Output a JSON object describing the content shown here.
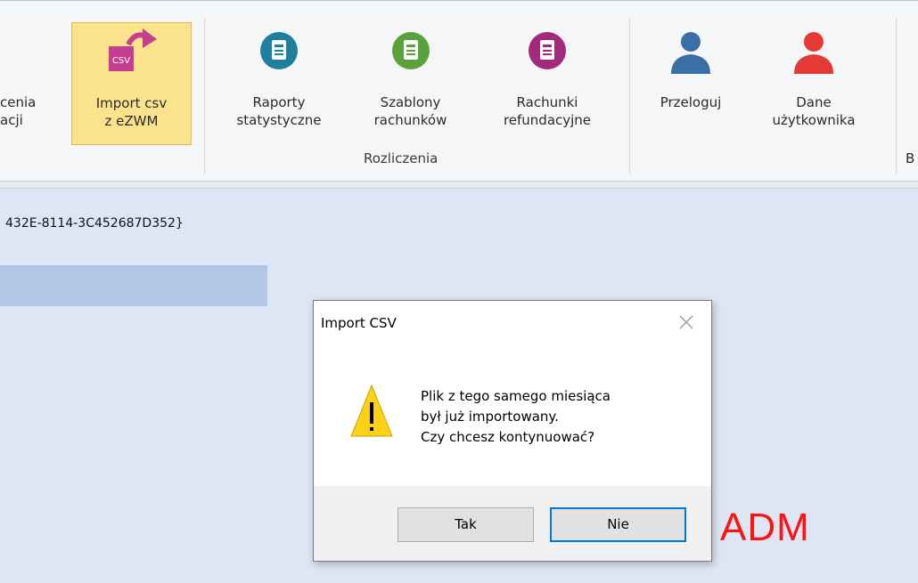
{
  "ribbon": {
    "cut_left_line1": "cenia",
    "cut_left_line2": "acji",
    "import_line1": "Import csv",
    "import_line2": "z eZWM",
    "csv_badge": "CSV",
    "raporty_line1": "Raporty",
    "raporty_line2": "statystyczne",
    "szablony_line1": "Szablony",
    "szablony_line2": "rachunków",
    "rachunki_line1": "Rachunki",
    "rachunki_line2": "refundacyjne",
    "group_rozliczenia": "Rozliczenia",
    "przeloguj": "Przeloguj",
    "dane_line1": "Dane",
    "dane_line2": "użytkownika",
    "cut_right": "B"
  },
  "content": {
    "guid_text": "432E-8114-3C452687D352}",
    "adm_label": "ADM"
  },
  "dialog": {
    "title": "Import CSV",
    "message_line1": "Plik z tego samego miesiąca",
    "message_line2": "był już importowany.",
    "message_line3": "Czy chcesz kontynuować?",
    "yes_label": "Tak",
    "no_label": "Nie"
  },
  "colors": {
    "raporty_icon": "#1f7f9e",
    "szablony_icon": "#5aa33a",
    "rachunki_icon": "#a2297c",
    "user_icon": "#3a6fa6",
    "user_active_icon": "#e53935",
    "import_arrow": "#c43f8f",
    "adm": "#ff1212"
  }
}
